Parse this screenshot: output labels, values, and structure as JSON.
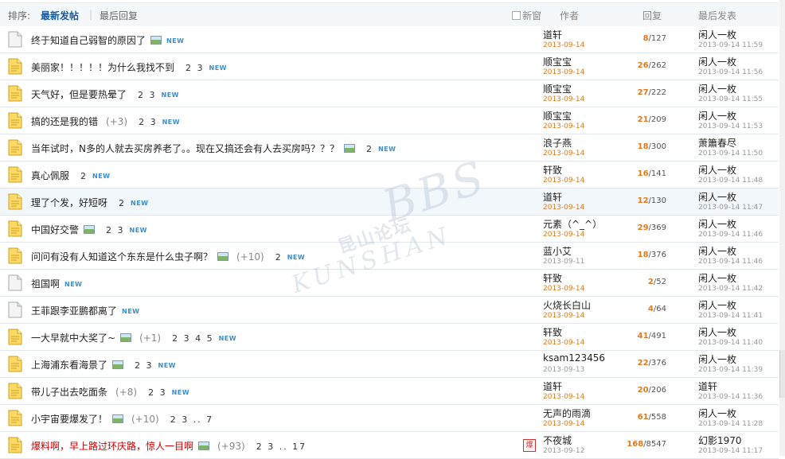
{
  "header": {
    "sort_label": "排序:",
    "sort_newest": "最新发帖",
    "separator": "|",
    "sort_last_reply": "最后回复",
    "new_window": "新窗",
    "col_author": "作者",
    "col_replies": "回复",
    "col_last_post": "最后发表"
  },
  "watermark": {
    "cn": "昆山论坛",
    "en": "KUNSHAN",
    "bbs": "BBS"
  },
  "threads": [
    {
      "title": "终于知道自己弱智的原因了",
      "img": true,
      "plus": "",
      "pages": "",
      "new": "NEW",
      "icon": "page",
      "hot": false,
      "author": "道轩",
      "author_date": "2013-09-14",
      "replies": "8",
      "views": "127",
      "last_author": "闲人一枚",
      "last_date": "2013-09-14 11:59"
    },
    {
      "title": "美丽家！！！！！为什么我找不到",
      "img": false,
      "plus": "",
      "pages": "2 3",
      "new": "NEW",
      "icon": "folder",
      "hot": false,
      "author": "顺宝宝",
      "author_date": "2013-09-14",
      "replies": "26",
      "views": "262",
      "last_author": "闲人一枚",
      "last_date": "2013-09-14 11:56"
    },
    {
      "title": "天气好，但是要热晕了",
      "img": false,
      "plus": "",
      "pages": "2 3",
      "new": "NEW",
      "icon": "folder",
      "hot": false,
      "author": "顺宝宝",
      "author_date": "2013-09-14",
      "replies": "27",
      "views": "222",
      "last_author": "闲人一枚",
      "last_date": "2013-09-14 11:55"
    },
    {
      "title": "搞的还是我的错",
      "img": false,
      "plus": "(+3)",
      "pages": "2 3",
      "new": "NEW",
      "icon": "folder",
      "hot": false,
      "author": "顺宝宝",
      "author_date": "2013-09-14",
      "replies": "21",
      "views": "209",
      "last_author": "闲人一枚",
      "last_date": "2013-09-14 11:53"
    },
    {
      "title": "当年试时，N多的人就去买房养老了。。现在又搞还会有人去买房吗？？？",
      "img": true,
      "plus": "",
      "pages": "2",
      "new": "NEW",
      "icon": "folder",
      "hot": false,
      "author": "浪子燕",
      "author_date": "2013-09-14",
      "replies": "18",
      "views": "300",
      "last_author": "萧簫春尽",
      "last_date": "2013-09-14 11:50"
    },
    {
      "title": "真心佩服",
      "img": false,
      "plus": "",
      "pages": "2",
      "new": "NEW",
      "icon": "folder",
      "hot": false,
      "author": "轩致",
      "author_date": "2013-09-14",
      "replies": "16",
      "views": "141",
      "last_author": "闲人一枚",
      "last_date": "2013-09-14 11:48"
    },
    {
      "title": "理了个发，好短呀",
      "img": false,
      "plus": "",
      "pages": "2",
      "new": "NEW",
      "icon": "folder",
      "hot": false,
      "author": "道轩",
      "author_date": "2013-09-14",
      "replies": "12",
      "views": "130",
      "last_author": "闲人一枚",
      "last_date": "2013-09-14 11:47"
    },
    {
      "title": "中国好交警",
      "img": true,
      "plus": "",
      "pages": "2 3",
      "new": "NEW",
      "icon": "folder",
      "hot": false,
      "author": "元素（^_^）",
      "author_date": "2013-09-14",
      "replies": "29",
      "views": "369",
      "last_author": "闲人一枚",
      "last_date": "2013-09-14 11:46"
    },
    {
      "title": "问问有没有人知道这个东东是什么虫子啊？",
      "img": true,
      "plus": "(+10)",
      "pages": "2",
      "new": "NEW",
      "icon": "folder",
      "hot": false,
      "author": "蓝小艾",
      "author_date": "2013-09-11",
      "replies": "18",
      "views": "376",
      "last_author": "闲人一枚",
      "last_date": "2013-09-14 11:46"
    },
    {
      "title": "祖国啊",
      "img": false,
      "plus": "",
      "pages": "",
      "new": "NEW",
      "icon": "page",
      "hot": false,
      "author": "轩致",
      "author_date": "2013-09-14",
      "replies": "2",
      "views": "52",
      "last_author": "闲人一枚",
      "last_date": "2013-09-14 11:42"
    },
    {
      "title": "王菲跟李亚鹏都离了",
      "img": false,
      "plus": "",
      "pages": "",
      "new": "NEW",
      "icon": "page",
      "hot": false,
      "author": "火烧长白山",
      "author_date": "2013-09-14",
      "replies": "4",
      "views": "64",
      "last_author": "闲人一枚",
      "last_date": "2013-09-14 11:41"
    },
    {
      "title": "一大早就中大奖了~",
      "img": true,
      "plus": "(+1)",
      "pages": "2 3 4 5",
      "new": "NEW",
      "icon": "folder",
      "hot": false,
      "author": "轩致",
      "author_date": "2013-09-14",
      "replies": "41",
      "views": "491",
      "last_author": "闲人一枚",
      "last_date": "2013-09-14 11:40"
    },
    {
      "title": "上海浦东看海景了",
      "img": true,
      "plus": "",
      "pages": "2 3",
      "new": "NEW",
      "icon": "folder",
      "hot": false,
      "author": "ksam123456",
      "author_date": "2013-09-13",
      "replies": "22",
      "views": "376",
      "last_author": "闲人一枚",
      "last_date": "2013-09-14 11:39"
    },
    {
      "title": "带儿子出去吃面条",
      "img": false,
      "plus": "(+8)",
      "pages": "2 3",
      "new": "NEW",
      "icon": "folder",
      "hot": false,
      "author": "道轩",
      "author_date": "2013-09-14",
      "replies": "20",
      "views": "206",
      "last_author": "道轩",
      "last_date": "2013-09-14 11:36"
    },
    {
      "title": "小宇宙要爆发了！",
      "img": true,
      "plus": "(+10)",
      "pages": "2 3 .. 7",
      "new": "",
      "icon": "folder",
      "hot": false,
      "author": "无声的雨滴",
      "author_date": "2013-09-14",
      "replies": "61",
      "views": "558",
      "last_author": "闲人一枚",
      "last_date": "2013-09-14 11:28"
    },
    {
      "title": "爆料啊，早上路过环庆路，惊人一目啊",
      "img": true,
      "plus": "(+93)",
      "pages": "2 3 .. 17",
      "new": "",
      "icon": "folder",
      "hot": true,
      "stamp": "爆",
      "author": "不夜城",
      "author_date": "2013-09-12",
      "replies": "168",
      "views": "8547",
      "last_author": "幻影1970",
      "last_date": "2013-09-14 11:17"
    }
  ]
}
